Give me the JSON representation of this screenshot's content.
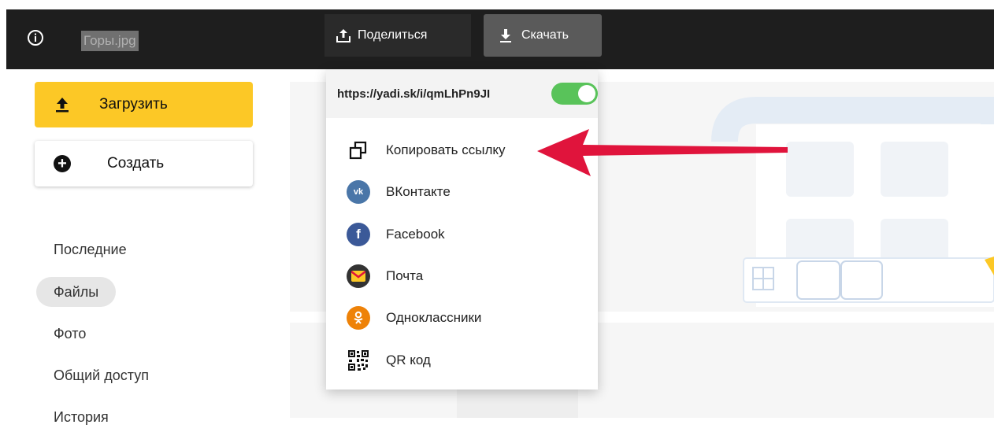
{
  "topbar": {
    "file_name": "Горы.jpg",
    "share_label": "Поделиться",
    "download_label": "Скачать"
  },
  "sidebar": {
    "upload_label": "Загрузить",
    "create_label": "Создать",
    "items": [
      {
        "label": "Последние"
      },
      {
        "label": "Файлы",
        "active": true
      },
      {
        "label": "Фото"
      },
      {
        "label": "Общий доступ"
      },
      {
        "label": "История"
      }
    ]
  },
  "share_menu": {
    "link": "https://yadi.sk/i/qmLhPn9JI",
    "link_enabled": true,
    "items": [
      {
        "label": "Копировать ссылку",
        "icon": "copy-link-icon"
      },
      {
        "label": "ВКонтакте",
        "icon": "vk-icon",
        "color": "#4a76a8"
      },
      {
        "label": "Facebook",
        "icon": "facebook-icon",
        "color": "#3b5998"
      },
      {
        "label": "Почта",
        "icon": "mail-icon",
        "color": "#333333"
      },
      {
        "label": "Одноклассники",
        "icon": "odnoklassniki-icon",
        "color": "#ee8208"
      },
      {
        "label": "QR код",
        "icon": "qr-code-icon"
      }
    ]
  },
  "colors": {
    "accent_yellow": "#fcc826",
    "toggle_on": "#59c35a",
    "annotation_arrow": "#e0143c"
  }
}
